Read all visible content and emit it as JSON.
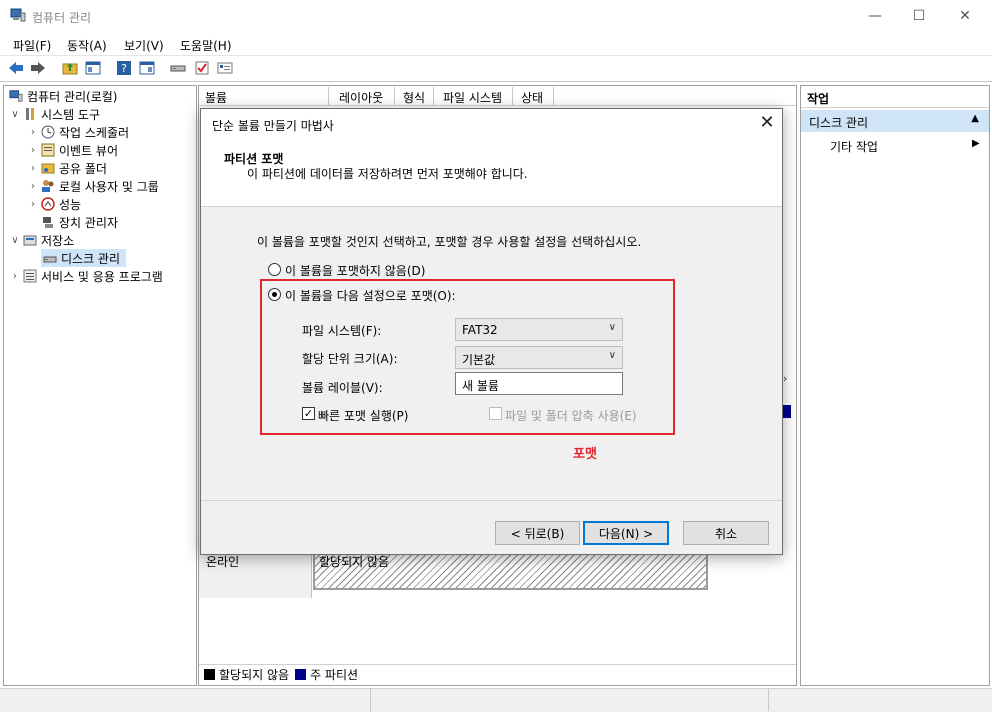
{
  "window": {
    "title": "컴퓨터 관리",
    "minimize": "—",
    "maximize": "☐",
    "close": "✕"
  },
  "menu": [
    "파일(F)",
    "동작(A)",
    "보기(V)",
    "도움말(H)"
  ],
  "tree": {
    "root": "컴퓨터 관리(로컬)",
    "system_tools": "시스템 도구",
    "task_scheduler": "작업 스케줄러",
    "event_viewer": "이벤트 뷰어",
    "shared_folders": "공유 폴더",
    "local_users": "로컬 사용자 및 그룹",
    "performance": "성능",
    "device_manager": "장치 관리자",
    "storage": "저장소",
    "disk_management": "디스크 관리",
    "services": "서비스 및 응용 프로그램"
  },
  "columns": [
    "볼륨",
    "레이아웃",
    "형식",
    "파일 시스템",
    "상태"
  ],
  "disk": {
    "status": "온라인",
    "unallocated": "할당되지 않음"
  },
  "legend": {
    "unallocated": "할당되지 않음",
    "primary": "주 파티션",
    "unallocated_color": "#000000",
    "primary_color": "#00008b"
  },
  "actions": {
    "title": "작업",
    "selected": "디스크 관리",
    "other": "기타 작업"
  },
  "dialog": {
    "title": "단순 볼륨 만들기 마법사",
    "heading": "파티션 포맷",
    "subheading": "이 파티션에 데이터를 저장하려면 먼저 포맷해야 합니다.",
    "instruction": "이 볼륨을 포맷할 것인지 선택하고, 포맷할 경우 사용할 설정을 선택하십시오.",
    "option_no_format": "이 볼륨을 포맷하지 않음(D)",
    "option_format": "이 볼륨을 다음 설정으로 포맷(O):",
    "fs_label": "파일 시스템(F):",
    "fs_value": "FAT32",
    "alloc_label": "할당 단위 크기(A):",
    "alloc_value": "기본값",
    "vol_label_label": "볼륨 레이블(V):",
    "vol_label_value": "새 볼륨",
    "quick_format": "빠른 포맷 실행(P)",
    "compression": "파일 및 폴더 압축 사용(E)",
    "back": "< 뒤로(B)",
    "next": "다음(N) >",
    "cancel": "취소",
    "format_selected": true,
    "quick_format_checked": true
  },
  "annotation": {
    "text": "포맷",
    "color": "#e3262d"
  }
}
